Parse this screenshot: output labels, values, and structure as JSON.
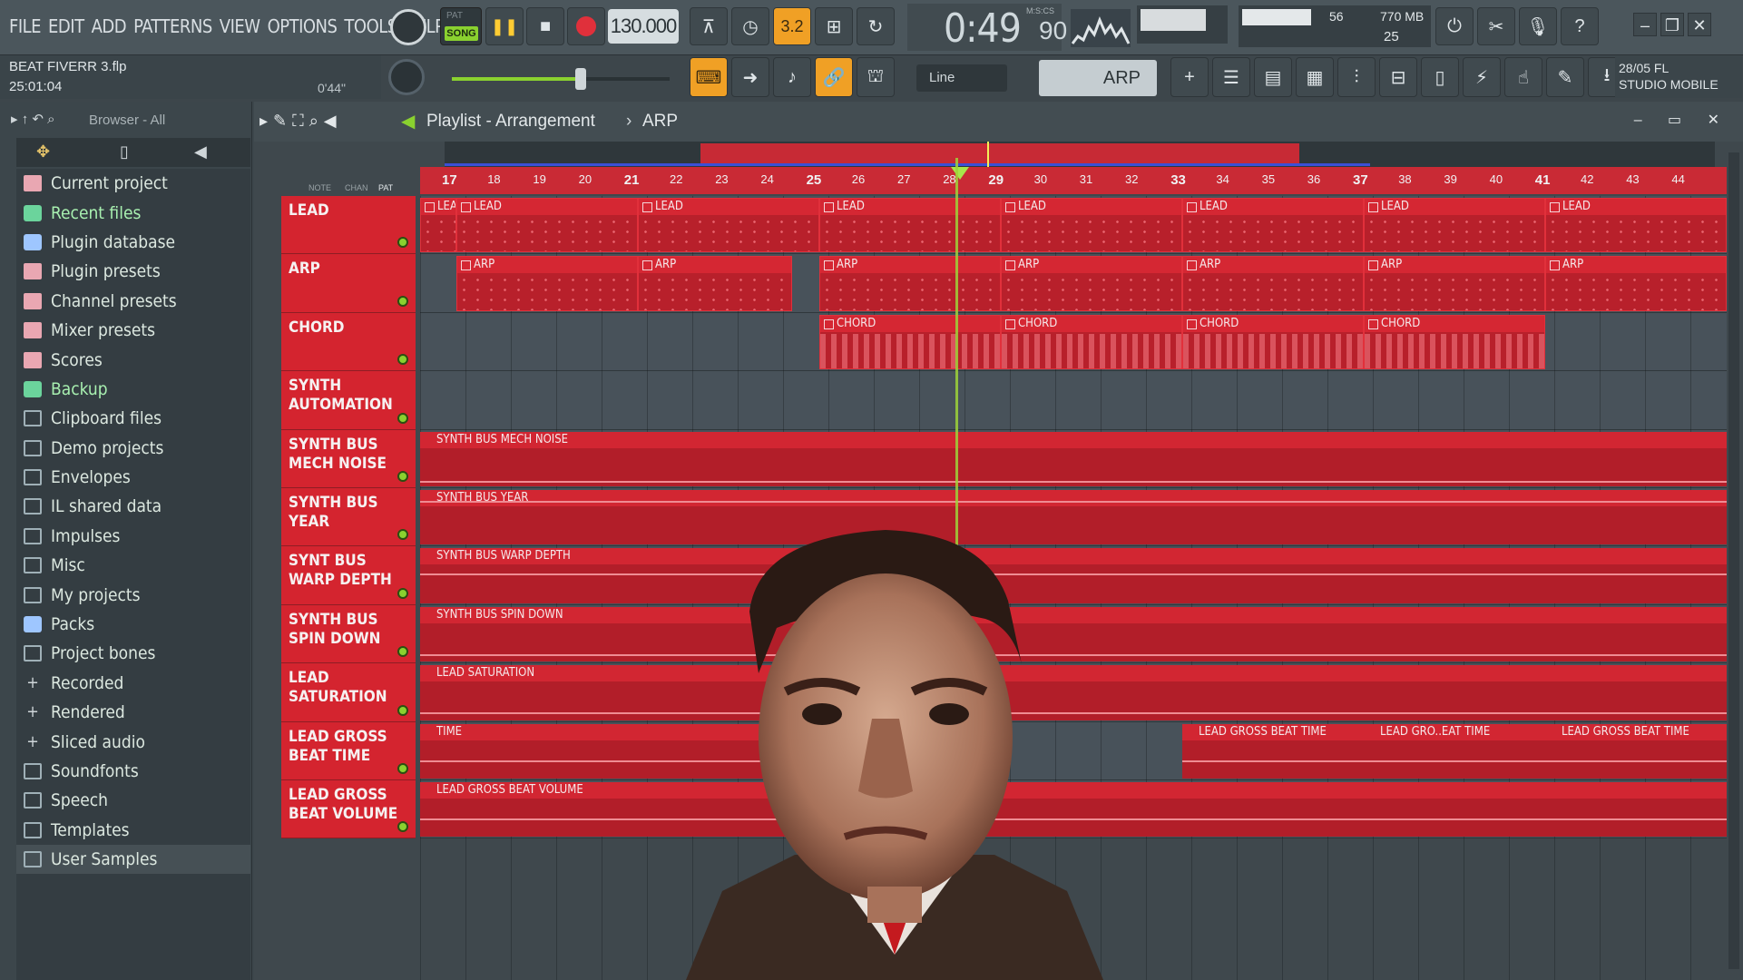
{
  "menu": [
    "FILE",
    "EDIT",
    "ADD",
    "PATTERNS",
    "VIEW",
    "OPTIONS",
    "TOOLS",
    "HELP"
  ],
  "transport": {
    "pat_label": "PAT",
    "song_label": "SONG",
    "tempo": "130.000",
    "time": "0:49",
    "time_sub": "90",
    "time_unit": "M:S:CS",
    "beat_indicator": "3.2"
  },
  "resources": {
    "cpu": "56",
    "memory": "770 MB",
    "polyphony": "25"
  },
  "project": {
    "name": "BEAT FIVERR 3.flp",
    "time": "25:01:04",
    "position": "0'44\""
  },
  "snap": "Line",
  "pattern": "ARP",
  "news": {
    "line1": "28/05  FL",
    "line2": "STUDIO MOBILE"
  },
  "browser": {
    "title": "Browser - All",
    "items": [
      {
        "label": "Current project",
        "icon": "special"
      },
      {
        "label": "Recent files",
        "icon": "green"
      },
      {
        "label": "Plugin database",
        "icon": "blue"
      },
      {
        "label": "Plugin presets",
        "icon": "special"
      },
      {
        "label": "Channel presets",
        "icon": "special"
      },
      {
        "label": "Mixer presets",
        "icon": "special"
      },
      {
        "label": "Scores",
        "icon": "special"
      },
      {
        "label": "Backup",
        "icon": "green"
      },
      {
        "label": "Clipboard files",
        "icon": "folder"
      },
      {
        "label": "Demo projects",
        "icon": "folder"
      },
      {
        "label": "Envelopes",
        "icon": "folder"
      },
      {
        "label": "IL shared data",
        "icon": "folder"
      },
      {
        "label": "Impulses",
        "icon": "folder"
      },
      {
        "label": "Misc",
        "icon": "folder"
      },
      {
        "label": "My projects",
        "icon": "folder"
      },
      {
        "label": "Packs",
        "icon": "blue"
      },
      {
        "label": "Project bones",
        "icon": "folder"
      },
      {
        "label": "Recorded",
        "icon": "plus"
      },
      {
        "label": "Rendered",
        "icon": "plus"
      },
      {
        "label": "Sliced audio",
        "icon": "plus"
      },
      {
        "label": "Soundfonts",
        "icon": "folder"
      },
      {
        "label": "Speech",
        "icon": "folder"
      },
      {
        "label": "Templates",
        "icon": "folder"
      },
      {
        "label": "User Samples",
        "icon": "folder"
      }
    ]
  },
  "playlist": {
    "title": "Playlist - Arrangement",
    "pattern": "ARP",
    "bars": [
      "17",
      "18",
      "19",
      "20",
      "21",
      "22",
      "23",
      "24",
      "25",
      "26",
      "27",
      "28",
      "29",
      "30",
      "31",
      "32",
      "33",
      "34",
      "35",
      "36",
      "37",
      "38",
      "39",
      "40",
      "41",
      "42",
      "43",
      "44"
    ],
    "tracks": [
      {
        "name": "LEAD"
      },
      {
        "name": "ARP"
      },
      {
        "name": "CHORD"
      },
      {
        "name": "SYNTH AUTOMATION"
      },
      {
        "name": "SYNTH BUS MECH NOISE"
      },
      {
        "name": "SYNTH BUS YEAR"
      },
      {
        "name": "SYNT BUS WARP DEPTH"
      },
      {
        "name": "SYNTH BUS SPIN DOWN"
      },
      {
        "name": "LEAD SATURATION"
      },
      {
        "name": "LEAD GROSS BEAT TIME"
      },
      {
        "name": "LEAD GROSS BEAT VOLUME"
      }
    ],
    "clip_labels": {
      "lead": "LEAD",
      "arp": "ARP",
      "chord": "CHORD",
      "mech": "SYNTH BUS MECH NOISE",
      "year": "SYNTH BUS YEAR",
      "warp": "SYNTH BUS WARP DEPTH",
      "spin": "SYNTH BUS SPIN DOWN",
      "sat": "LEAD SATURATION",
      "gbt": "LEAD GROSS BEAT TIME",
      "gbt_short": "LEAD GRO..EAT TIME",
      "gbt_partial": "TIME",
      "gbv": "LEAD GROSS BEAT VOLUME"
    }
  }
}
